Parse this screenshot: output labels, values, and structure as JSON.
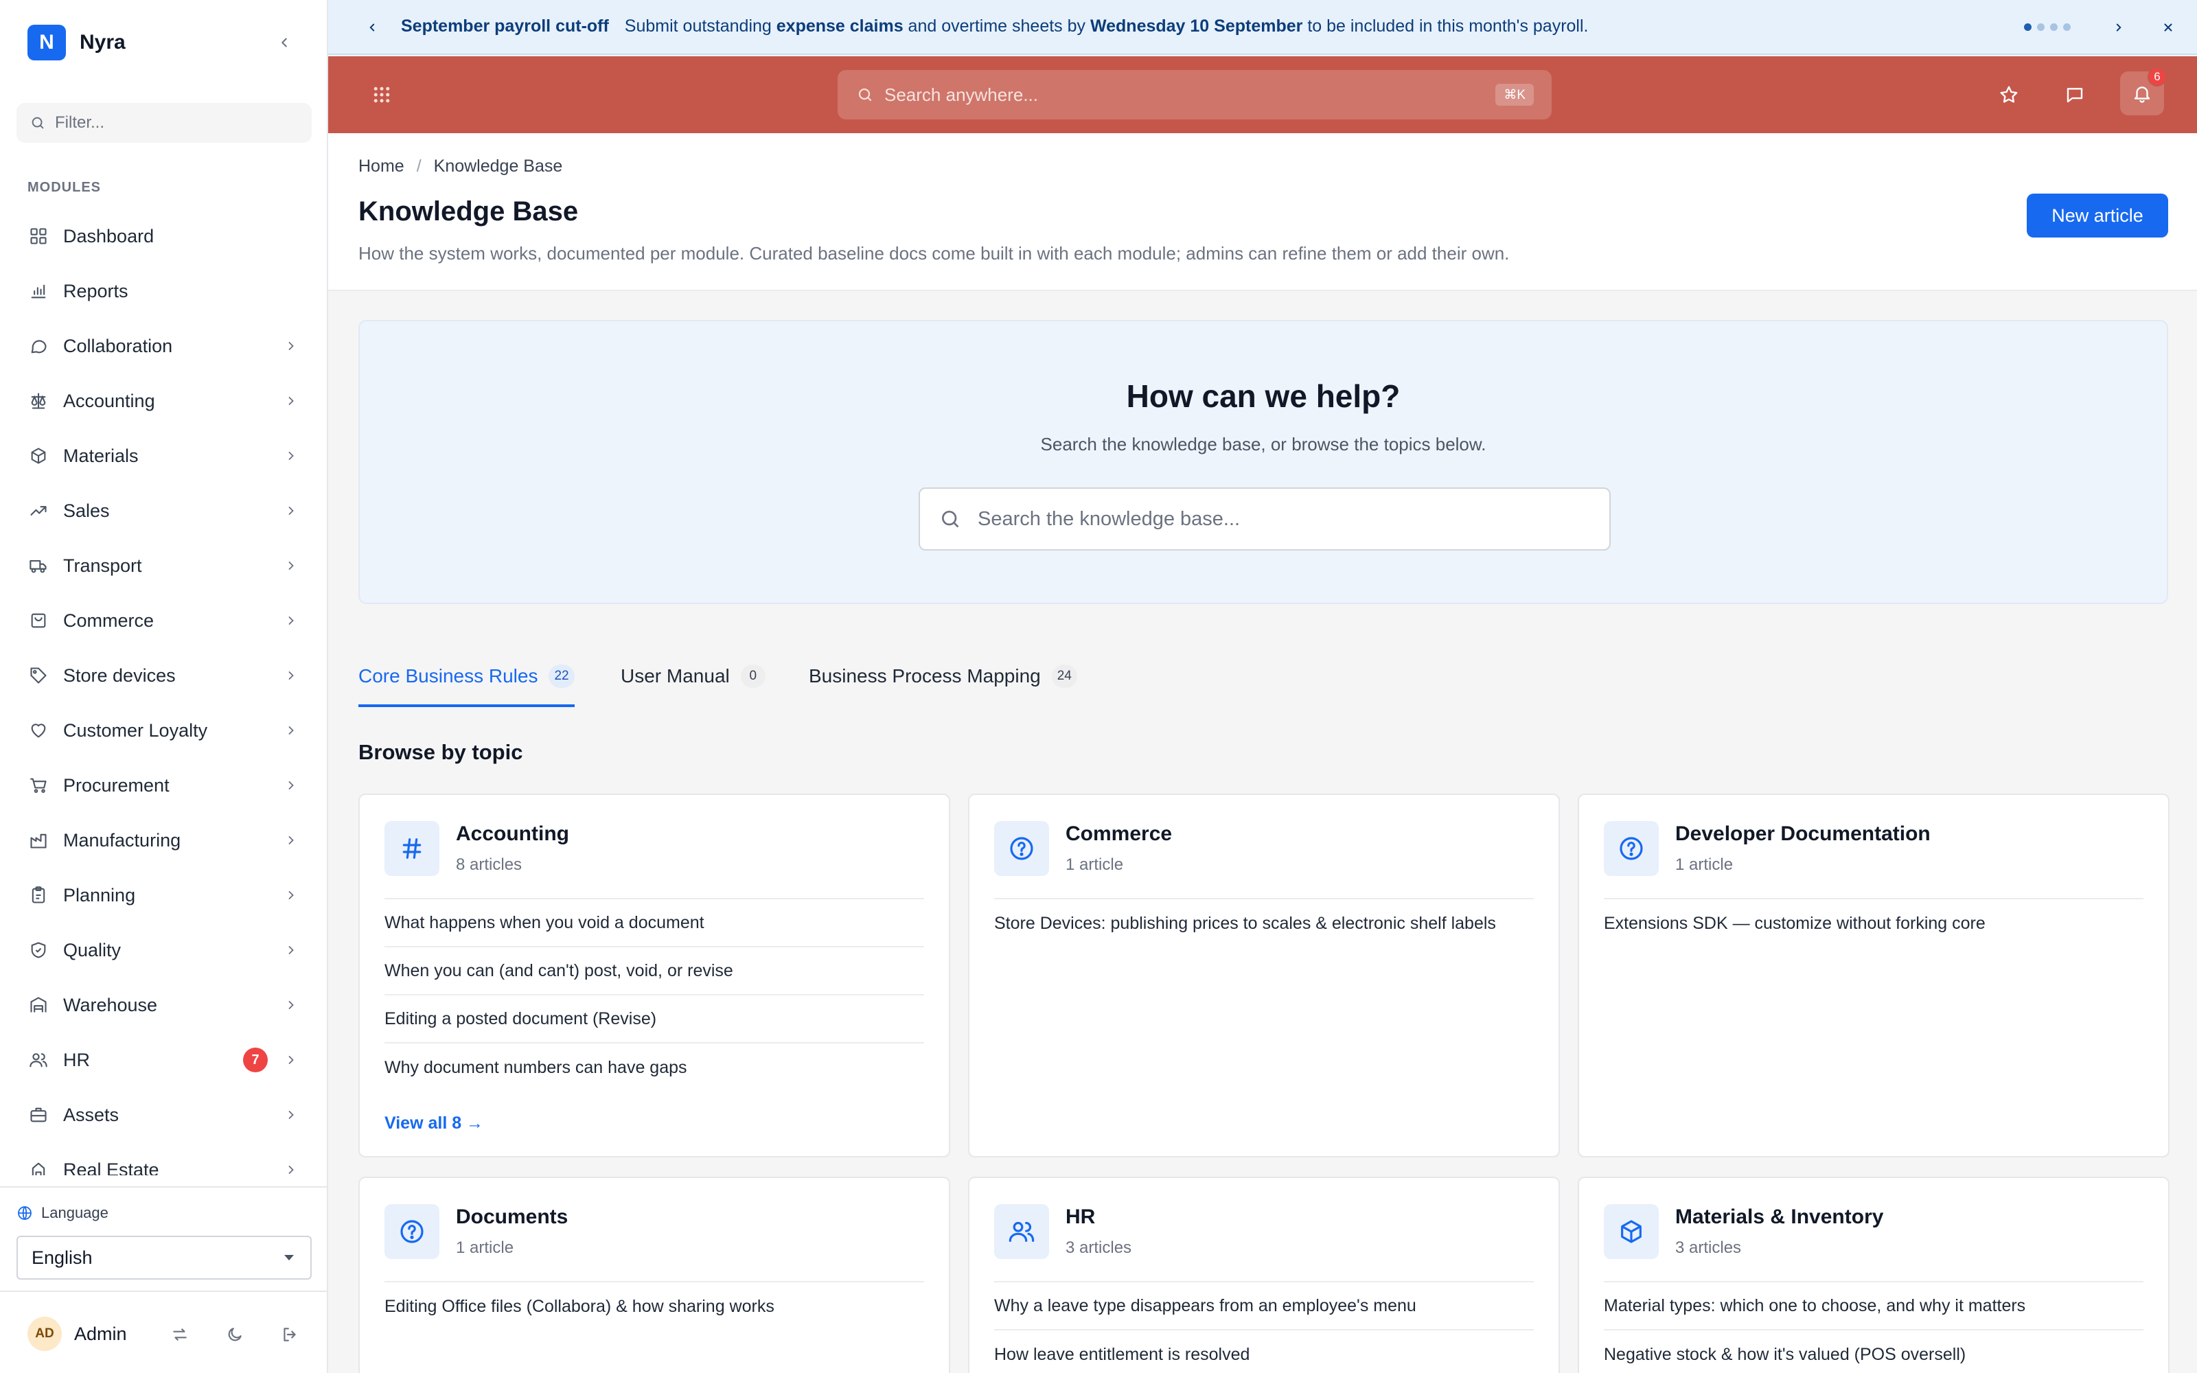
{
  "brand": {
    "initial": "N",
    "name": "Nyra"
  },
  "sidebar": {
    "filter_placeholder": "Filter...",
    "section_label": "MODULES",
    "items": [
      {
        "label": "Dashboard",
        "icon": "dashboard-icon",
        "chevron": false
      },
      {
        "label": "Reports",
        "icon": "bar-chart-icon",
        "chevron": false
      },
      {
        "label": "Collaboration",
        "icon": "chat-bubble-icon",
        "chevron": true
      },
      {
        "label": "Accounting",
        "icon": "scale-icon",
        "chevron": true
      },
      {
        "label": "Materials",
        "icon": "box-icon",
        "chevron": true
      },
      {
        "label": "Sales",
        "icon": "trending-up-icon",
        "chevron": true
      },
      {
        "label": "Transport",
        "icon": "truck-icon",
        "chevron": true
      },
      {
        "label": "Commerce",
        "icon": "shopping-bag-icon",
        "chevron": true
      },
      {
        "label": "Store devices",
        "icon": "tag-icon",
        "chevron": true
      },
      {
        "label": "Customer Loyalty",
        "icon": "heart-icon",
        "chevron": true
      },
      {
        "label": "Procurement",
        "icon": "cart-icon",
        "chevron": true
      },
      {
        "label": "Manufacturing",
        "icon": "factory-icon",
        "chevron": true
      },
      {
        "label": "Planning",
        "icon": "clipboard-icon",
        "chevron": true
      },
      {
        "label": "Quality",
        "icon": "shield-check-icon",
        "chevron": true
      },
      {
        "label": "Warehouse",
        "icon": "warehouse-icon",
        "chevron": true
      },
      {
        "label": "HR",
        "icon": "users-icon",
        "chevron": true,
        "badge": "7"
      },
      {
        "label": "Assets",
        "icon": "briefcase-icon",
        "chevron": true
      },
      {
        "label": "Real Estate",
        "icon": "building-icon",
        "chevron": true
      }
    ],
    "language_label": "Language",
    "language_value": "English",
    "user_initials": "AD",
    "user_name": "Admin"
  },
  "announcement": {
    "title": "September payroll cut-off",
    "text_1": "Submit outstanding ",
    "bold_1": "expense claims",
    "text_2": " and overtime sheets by ",
    "bold_2": "Wednesday 10 September",
    "text_3": " to be included in this month's payroll."
  },
  "topbar": {
    "search_placeholder": "Search anywhere...",
    "shortcut": "⌘K",
    "notification_count": "6"
  },
  "page": {
    "breadcrumb": [
      "Home",
      "Knowledge Base"
    ],
    "title": "Knowledge Base",
    "subtitle": "How the system works, documented per module. Curated baseline docs come built in with each module; admins can refine them or add their own.",
    "new_button": "New article"
  },
  "hero": {
    "title": "How can we help?",
    "subtitle": "Search the knowledge base, or browse the topics below.",
    "search_placeholder": "Search the knowledge base..."
  },
  "tabs": [
    {
      "label": "Core Business Rules",
      "count": "22",
      "active": true
    },
    {
      "label": "User Manual",
      "count": "0",
      "active": false
    },
    {
      "label": "Business Process Mapping",
      "count": "24",
      "active": false
    }
  ],
  "browse_title": "Browse by topic",
  "cards": [
    {
      "title": "Accounting",
      "subtitle": "8 articles",
      "icon": "hash-icon",
      "articles": [
        "What happens when you void a document",
        "When you can (and can't) post, void, or revise",
        "Editing a posted document (Revise)",
        "Why document numbers can have gaps"
      ],
      "view_all": "View all 8 →"
    },
    {
      "title": "Commerce",
      "subtitle": "1 article",
      "icon": "help-circle-icon",
      "articles": [
        "Store Devices: publishing prices to scales & electronic shelf labels"
      ]
    },
    {
      "title": "Developer Documentation",
      "subtitle": "1 article",
      "icon": "help-circle-icon",
      "articles": [
        "Extensions SDK — customize without forking core"
      ]
    },
    {
      "title": "Documents",
      "subtitle": "1 article",
      "icon": "help-circle-icon",
      "articles": [
        "Editing Office files (Collabora) & how sharing works"
      ]
    },
    {
      "title": "HR",
      "subtitle": "3 articles",
      "icon": "users-icon",
      "articles": [
        "Why a leave type disappears from an employee's menu",
        "How leave entitlement is resolved"
      ]
    },
    {
      "title": "Materials & Inventory",
      "subtitle": "3 articles",
      "icon": "cube-icon",
      "articles": [
        "Material types: which one to choose, and why it matters",
        "Negative stock & how it's valued (POS oversell)"
      ]
    }
  ]
}
